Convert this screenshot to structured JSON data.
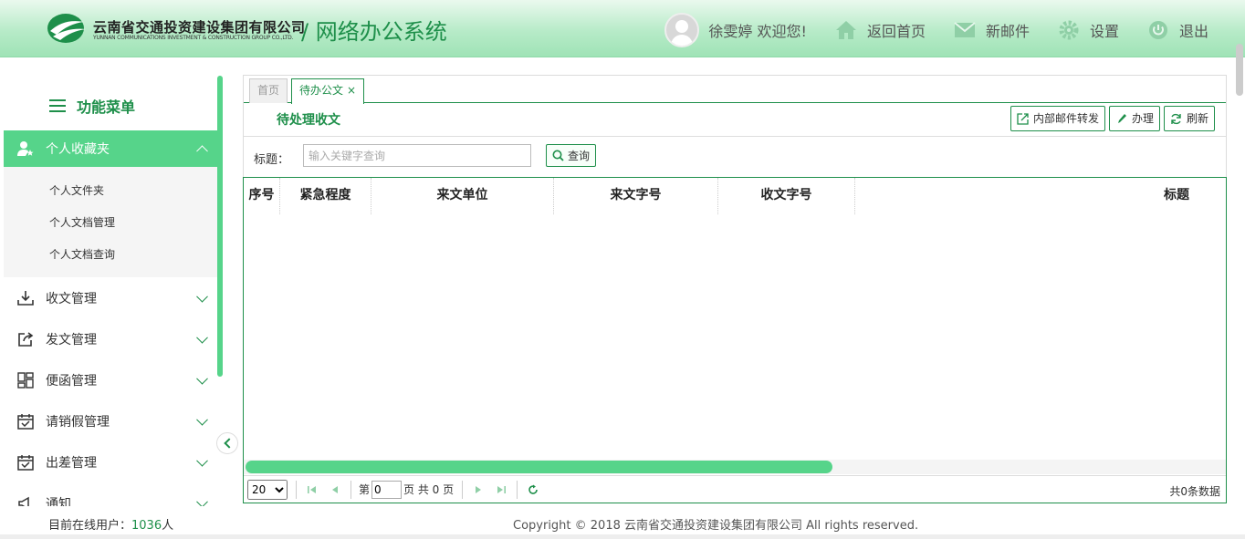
{
  "header": {
    "company_cn": "云南省交通投资建设集团有限公司",
    "company_en": "YUNNAN COMMUNICATIONS INVESTMENT & CONSTRUCTION GROUP CO.,LTD.",
    "system_title": "/ 网络办公系统",
    "user_greeting": "徐雯婷 欢迎您!",
    "nav": {
      "home": "返回首页",
      "mail": "新邮件",
      "settings": "设置",
      "logout": "退出"
    }
  },
  "sidebar": {
    "title": "功能菜单",
    "items": [
      {
        "label": "个人收藏夹",
        "icon": "user-favorite-icon",
        "expanded": true,
        "children": [
          "个人文件夹",
          "个人文档管理",
          "个人文档查询"
        ]
      },
      {
        "label": "收文管理",
        "icon": "download-icon"
      },
      {
        "label": "发文管理",
        "icon": "share-out-icon"
      },
      {
        "label": "便函管理",
        "icon": "grid-icon"
      },
      {
        "label": "请销假管理",
        "icon": "calendar-check-icon"
      },
      {
        "label": "出差管理",
        "icon": "calendar-check-icon"
      },
      {
        "label": "通知",
        "icon": "megaphone-icon"
      }
    ]
  },
  "tabs": [
    {
      "label": "首页"
    },
    {
      "label": "待办公文",
      "close": "×"
    }
  ],
  "page": {
    "heading": "待处理收文",
    "toolbar": {
      "forward": "内部邮件转发",
      "handle": "办理",
      "refresh": "刷新"
    },
    "search": {
      "label": "标题：",
      "placeholder": "输入关键字查询",
      "button": "查询"
    },
    "table": {
      "columns": [
        "序号",
        "紧急程度",
        "来文单位",
        "来文字号",
        "收文字号",
        "标题"
      ],
      "rows": []
    },
    "pager": {
      "page_size": "20",
      "page_prefix": "第",
      "current_page": "0",
      "page_suffix": "页 共 0 页",
      "total": "共0条数据"
    }
  },
  "footer": {
    "online_label": "目前在线用户：",
    "online_count": "1036",
    "online_unit": "人",
    "copyright": "Copyright © 2018 云南省交通投资建设集团有限公司 All rights reserved."
  },
  "colors": {
    "accent": "#1e8f4a",
    "highlight": "#56d48a"
  }
}
